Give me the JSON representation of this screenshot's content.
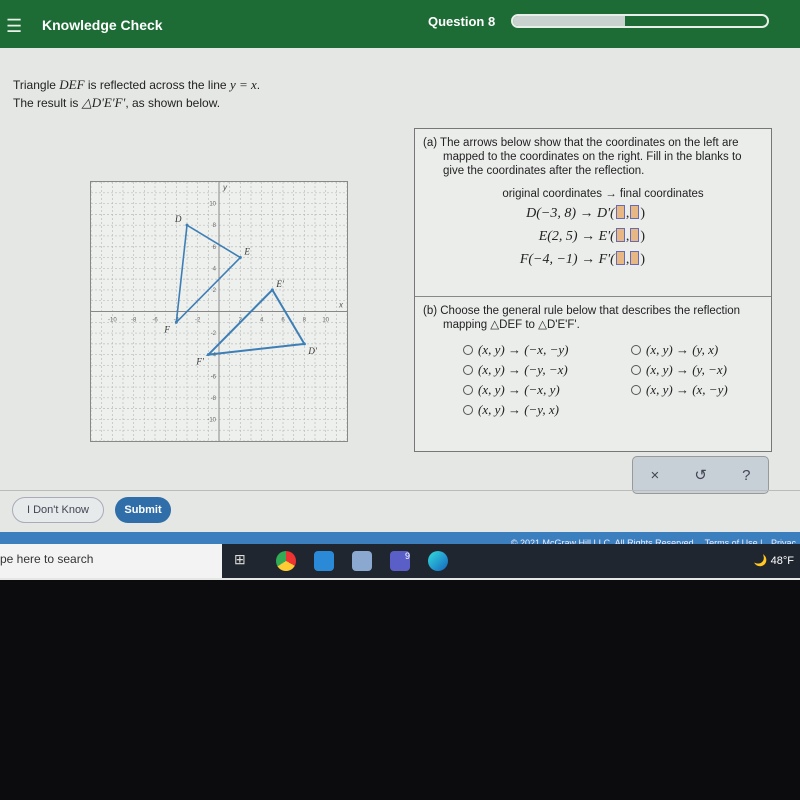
{
  "header": {
    "menu_icon": "hamburger-icon",
    "title": "Knowledge Check",
    "question": "Question 8",
    "progress_percent": 44
  },
  "prompt": {
    "line1_pre": "Triangle ",
    "line1_tri": "DEF",
    "line1_mid": " is reflected across the line ",
    "line1_eq": "y = x",
    "line1_end": ".",
    "line2_pre": "The result is ",
    "line2_tri": "△D'E'F'",
    "line2_end": ", as shown below."
  },
  "graph": {
    "xlabel": "x",
    "ylabel": "y",
    "range": [
      -12,
      12
    ],
    "ticks": [
      -10,
      -8,
      -6,
      -4,
      -2,
      2,
      4,
      6,
      8,
      10
    ],
    "triangles": [
      {
        "points": [
          {
            "label": "D",
            "x": -3,
            "y": 8
          },
          {
            "label": "E",
            "x": 2,
            "y": 5
          },
          {
            "label": "F",
            "x": -4,
            "y": -1
          }
        ]
      },
      {
        "points": [
          {
            "label": "D'",
            "x": 8,
            "y": -3
          },
          {
            "label": "E'",
            "x": 5,
            "y": 2
          },
          {
            "label": "F'",
            "x": -1,
            "y": -4
          }
        ]
      }
    ],
    "color": "#3d7fb5"
  },
  "part_a": {
    "text": "(a) The arrows below show that the coordinates on the left are mapped to the coordinates on the right. Fill in the blanks to give the coordinates after the reflection.",
    "header": "original coordinates → final coordinates",
    "rows": [
      {
        "orig": "D(−3, 8) →",
        "img": "D'("
      },
      {
        "orig": "E(2, 5) →",
        "img": "E'("
      },
      {
        "orig": "F(−4, −1) →",
        "img": "F'("
      }
    ]
  },
  "part_b": {
    "text": "(b) Choose the general rule below that describes the reflection mapping △DEF to △D'E'F'.",
    "options": [
      "(x, y) → (−x, −y)",
      "(x, y) → (y, x)",
      "(x, y) → (−y, −x)",
      "(x, y) → (y, −x)",
      "(x, y) → (−x, y)",
      "(x, y) → (x, −y)",
      "(x, y) → (−y, x)"
    ]
  },
  "tools": {
    "clear": "×",
    "undo": "↺",
    "help": "?"
  },
  "buttons": {
    "dont_know": "I Don't Know",
    "submit": "Submit"
  },
  "footer": {
    "copyright": "© 2021 McGraw Hill LLC. All Rights Reserved.",
    "terms": "Terms of Use",
    "privacy": "Privac"
  },
  "taskbar": {
    "search": "pe here to search",
    "weather": "48°F",
    "teams_badge": "9"
  }
}
